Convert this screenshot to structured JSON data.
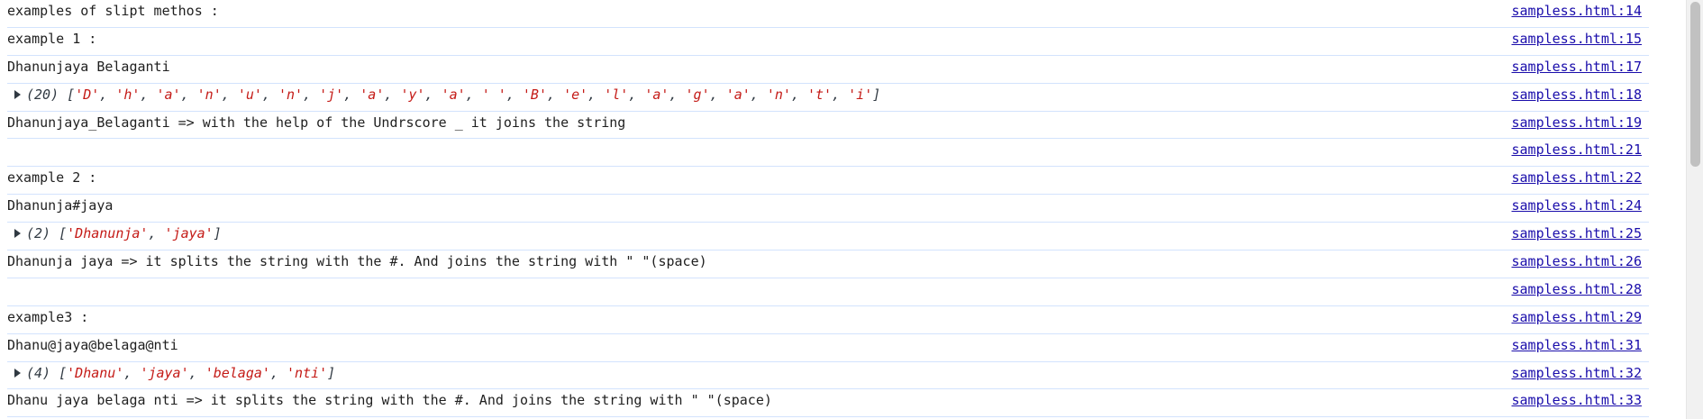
{
  "console": {
    "rows": [
      {
        "type": "text",
        "text": "examples of slipt methos :",
        "source": "sampless.html:14"
      },
      {
        "type": "text",
        "text": "example 1 :",
        "source": "sampless.html:15"
      },
      {
        "type": "text",
        "text": "Dhanunjaya Belaganti",
        "source": "sampless.html:17"
      },
      {
        "type": "array",
        "count": "(20)",
        "items": [
          "'D'",
          "'h'",
          "'a'",
          "'n'",
          "'u'",
          "'n'",
          "'j'",
          "'a'",
          "'y'",
          "'a'",
          "' '",
          "'B'",
          "'e'",
          "'l'",
          "'a'",
          "'g'",
          "'a'",
          "'n'",
          "'t'",
          "'i'"
        ],
        "source": "sampless.html:18"
      },
      {
        "type": "text",
        "text": "Dhanunjaya_Belaganti => with the help of the Undrscore _ it joins the string",
        "source": "sampless.html:19"
      },
      {
        "type": "text",
        "text": "",
        "source": "sampless.html:21"
      },
      {
        "type": "text",
        "text": "example 2 :",
        "source": "sampless.html:22"
      },
      {
        "type": "text",
        "text": "Dhanunja#jaya",
        "source": "sampless.html:24"
      },
      {
        "type": "array",
        "count": "(2)",
        "items": [
          "'Dhanunja'",
          "'jaya'"
        ],
        "source": "sampless.html:25"
      },
      {
        "type": "text",
        "text": "Dhanunja jaya => it splits the string with the #. And joins the string with \" \"(space)",
        "source": "sampless.html:26"
      },
      {
        "type": "text",
        "text": "",
        "source": "sampless.html:28"
      },
      {
        "type": "text",
        "text": "example3 :",
        "source": "sampless.html:29"
      },
      {
        "type": "text",
        "text": "Dhanu@jaya@belaga@nti",
        "source": "sampless.html:31"
      },
      {
        "type": "array",
        "count": "(4)",
        "items": [
          "'Dhanu'",
          "'jaya'",
          "'belaga'",
          "'nti'"
        ],
        "source": "sampless.html:32"
      },
      {
        "type": "text",
        "text": "Dhanu jaya belaga nti => it splits the string with the #. And joins the string with \" \"(space)",
        "source": "sampless.html:33"
      }
    ]
  },
  "colors": {
    "link": "#1a0dab",
    "string": "#c41a16",
    "row_border": "#d3e3fd"
  },
  "icons": {
    "expand": "caret-right-icon"
  }
}
